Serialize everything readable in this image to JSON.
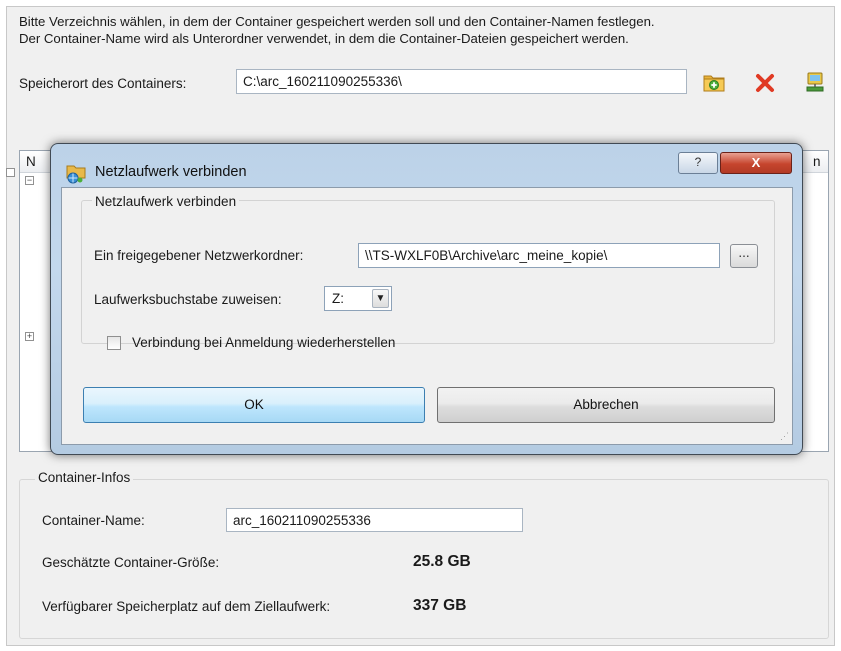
{
  "main": {
    "intro_line1": "Bitte Verzeichnis wählen, in dem der Container gespeichert werden soll und den Container-Namen festlegen.",
    "intro_line2": "Der Container-Name wird als Unterordner verwendet, in dem die Container-Dateien gespeichert werden.",
    "location_label": "Speicherort des Containers:",
    "location_value": "C:\\arc_160211090255336\\",
    "toolbar_icons": [
      "new-folder-icon",
      "delete-icon",
      "network-drive-icon"
    ],
    "tree_header_left": "N",
    "tree_header_right": "n"
  },
  "container_infos": {
    "legend": "Container-Infos",
    "name_label": "Container-Name:",
    "name_value": "arc_160211090255336",
    "size_label": "Geschätzte Container-Größe:",
    "size_value": "25.8 GB",
    "free_label": "Verfügbarer Speicherplatz auf dem Ziellaufwerk:",
    "free_value": "337 GB"
  },
  "dialog": {
    "title": "Netzlaufwerk verbinden",
    "help_label": "?",
    "close_label": "X",
    "group_legend": "Netzlaufwerk verbinden",
    "share_label": "Ein freigegebener Netzwerkordner:",
    "share_value": "\\\\TS-WXLF0B\\Archive\\arc_meine_kopie\\",
    "browse_label": "...",
    "drive_label": "Laufwerksbuchstabe zuweisen:",
    "drive_value": "Z:",
    "reconnect_label": "Verbindung bei Anmeldung wiederherstellen",
    "reconnect_checked": false,
    "ok_label": "OK",
    "cancel_label": "Abbrechen"
  }
}
